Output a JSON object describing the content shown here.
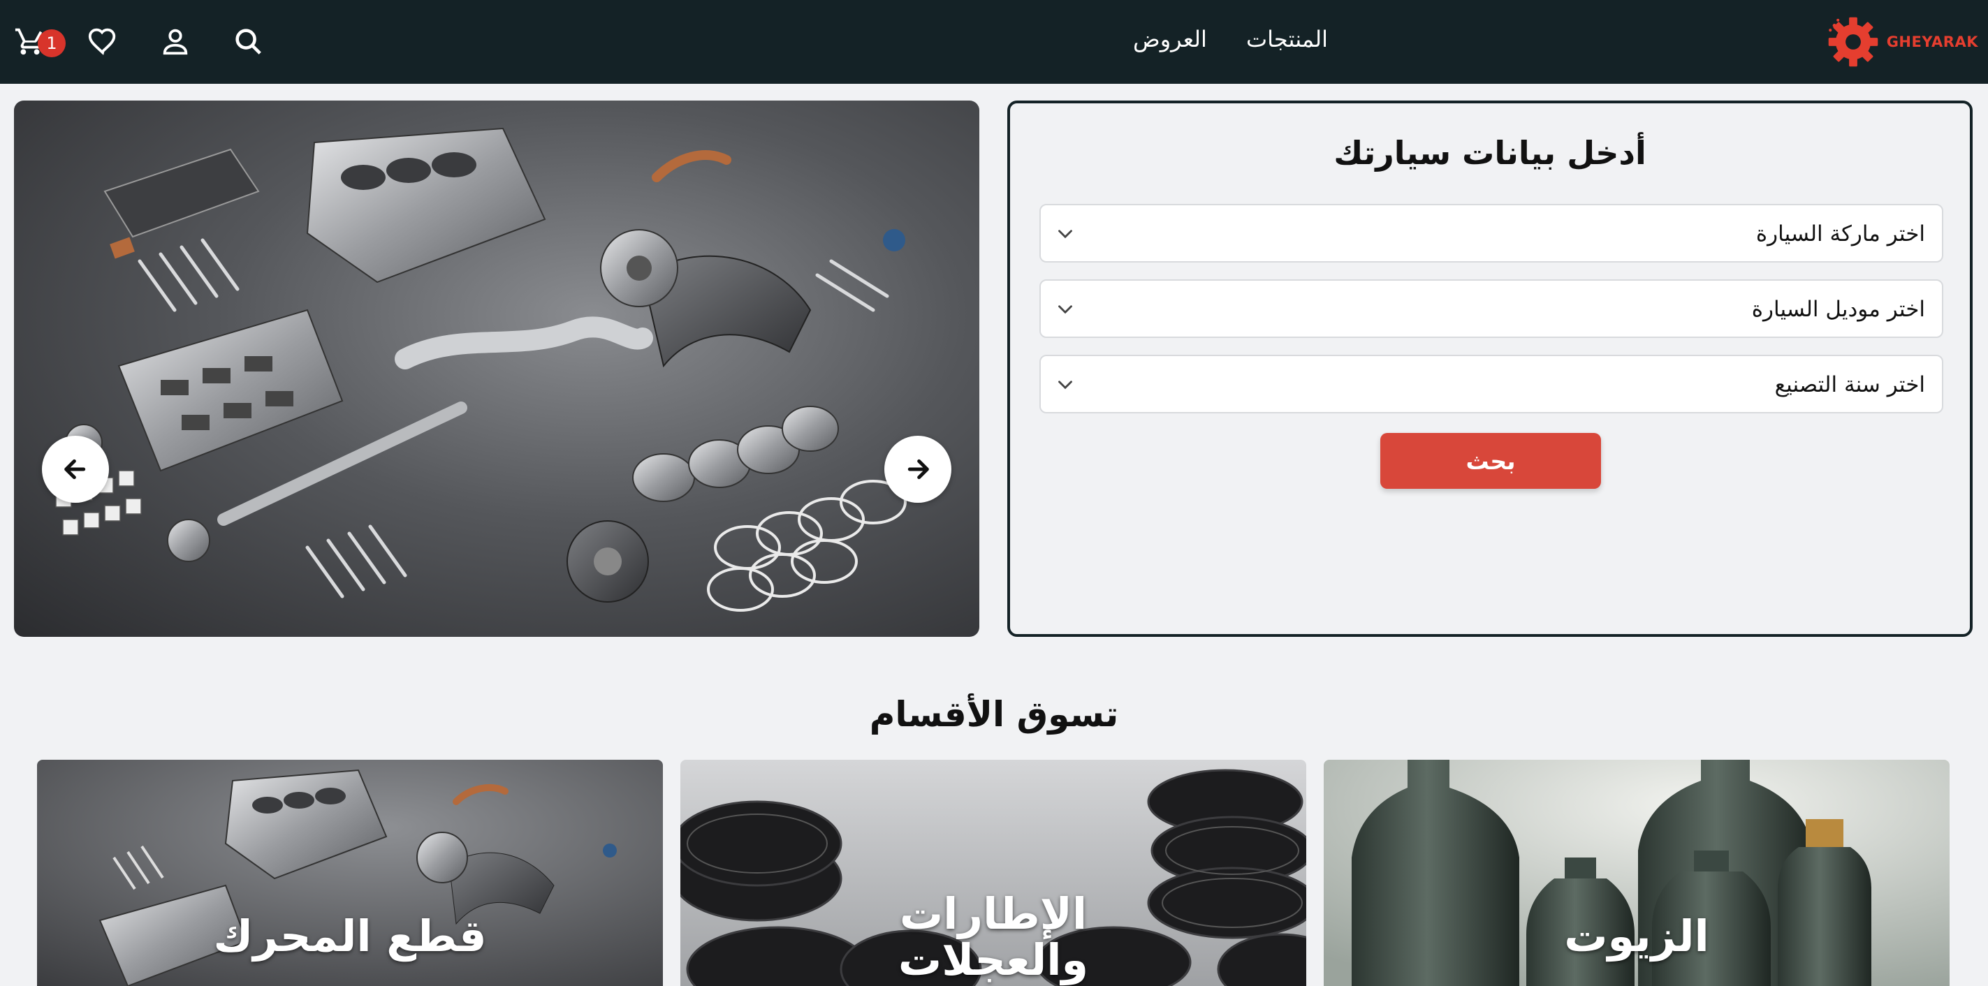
{
  "header": {
    "cart_count": "1",
    "nav": [
      "العروض",
      "المنتجات"
    ],
    "logo_text": "GHEYARAK",
    "icons": [
      "cart-icon",
      "heart-icon",
      "user-icon",
      "search-icon",
      "gear-logo-icon"
    ]
  },
  "slider": {
    "prev_icon": "arrow-left-icon",
    "next_icon": "arrow-right-icon",
    "dots": 3,
    "active_dot": 1
  },
  "form": {
    "title": "أدخل بيانات سيارتك",
    "make_placeholder": "اختر ماركة السيارة",
    "model_placeholder": "اختر موديل السيارة",
    "year_placeholder": "اختر سنة التصنيع",
    "search_label": "بحث"
  },
  "categories": {
    "title": "تسوق الأقسام",
    "items": [
      {
        "label": "قطع المحرك"
      },
      {
        "label": "الإطارات والعجلات"
      },
      {
        "label": "الزيوت"
      }
    ]
  },
  "colors": {
    "header_bg": "#142226",
    "accent": "#d8473a",
    "badge": "#d8342b",
    "logo": "#e53e2f",
    "page_bg": "#f1f2f4"
  }
}
